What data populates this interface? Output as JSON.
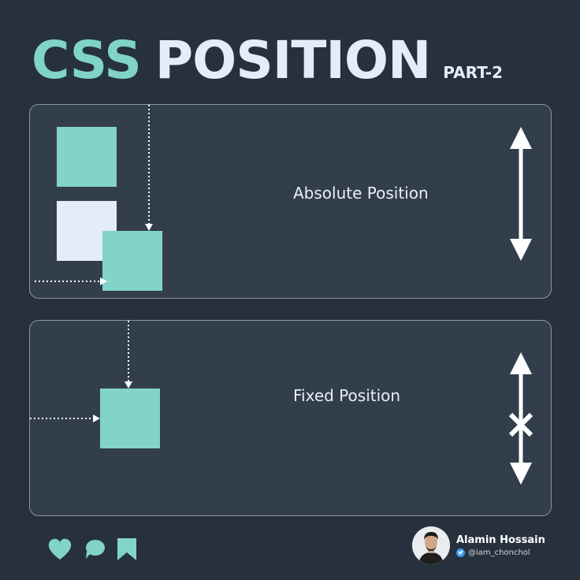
{
  "title": {
    "part1": "CSS",
    "part2": "POSITION",
    "part3": "PART-2"
  },
  "panels": [
    {
      "label": "Absolute Position",
      "scroll_indicator": "double-arrow-icon"
    },
    {
      "label": "Fixed Position",
      "scroll_indicator": "double-arrow-crossed-icon"
    }
  ],
  "footer": {
    "icons": [
      "heart-icon",
      "comment-icon",
      "bookmark-icon"
    ]
  },
  "author": {
    "name": "Alamin Hossain",
    "handle": "@iam_chonchol"
  },
  "colors": {
    "background": "#27313d",
    "panel": "#323e4b",
    "accent": "#82d3c8",
    "light": "#e4ecf7"
  }
}
